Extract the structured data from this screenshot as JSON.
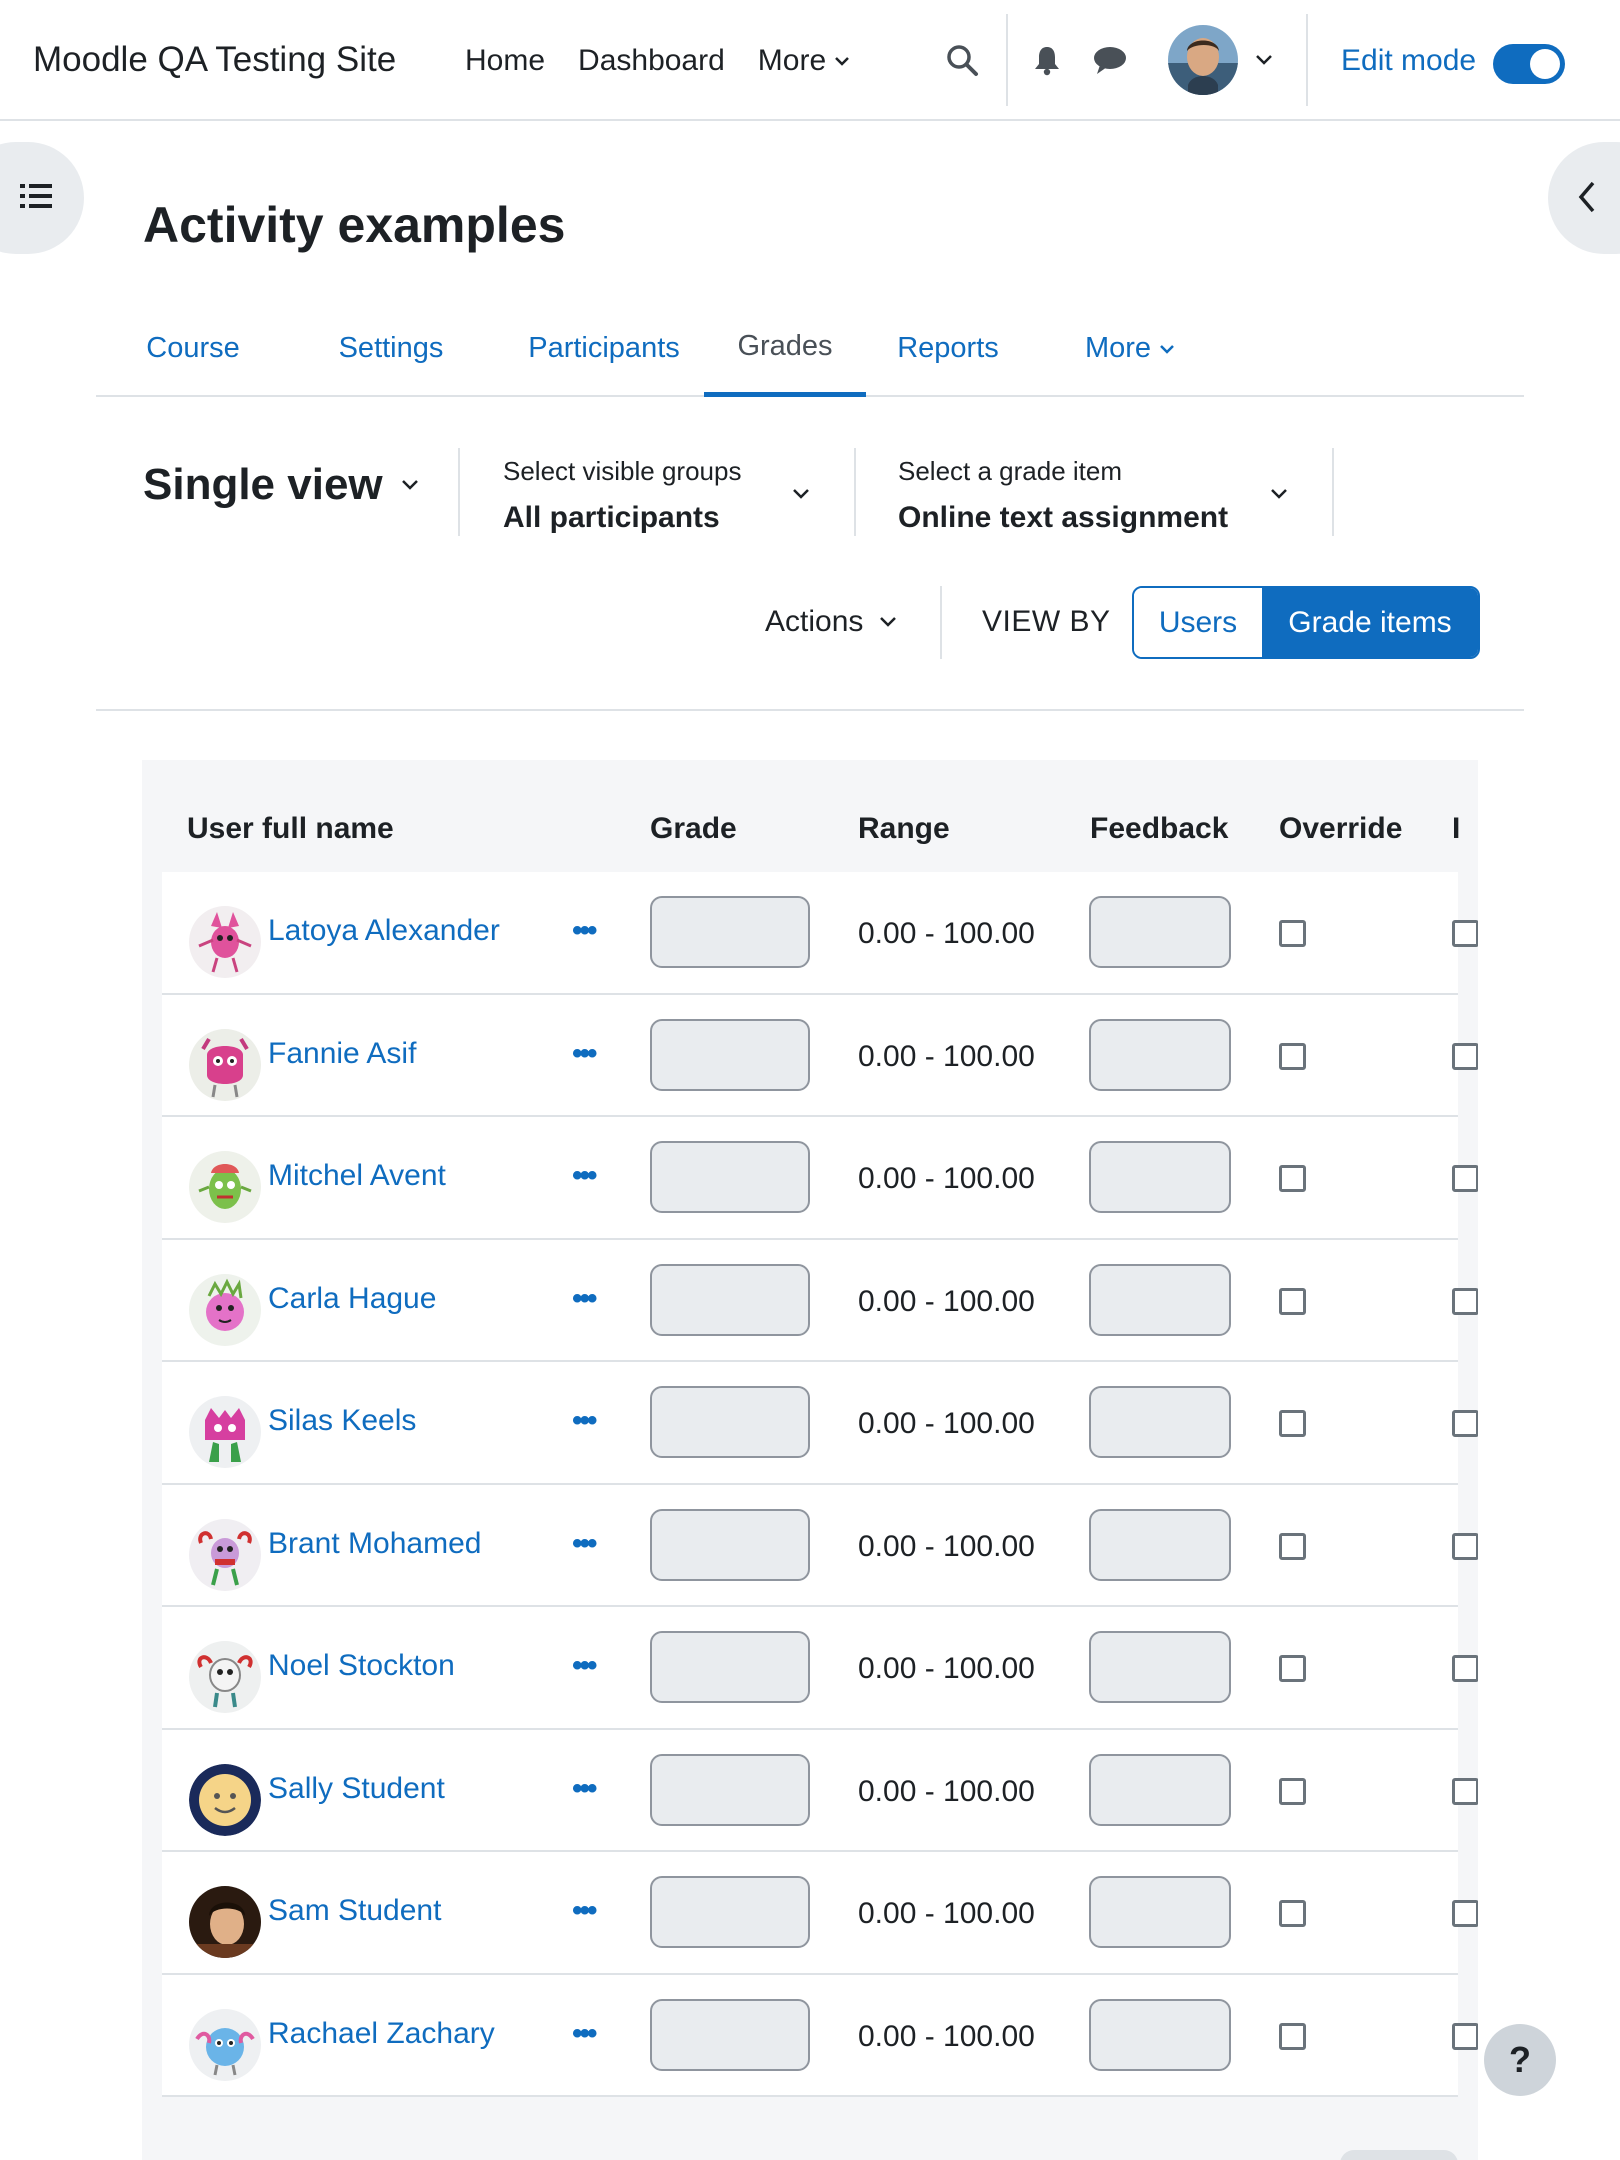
{
  "navbar": {
    "site_name": "Moodle QA Testing Site",
    "links": [
      "Home",
      "Dashboard",
      "More"
    ],
    "edit_mode_label": "Edit mode",
    "edit_mode_on": true,
    "icons": [
      "search-icon",
      "bell-icon",
      "chat-icon",
      "chevron-down-icon"
    ]
  },
  "page": {
    "title": "Activity examples"
  },
  "tabs": {
    "items": [
      "Course",
      "Settings",
      "Participants",
      "Grades",
      "Reports",
      "More"
    ],
    "active": "Grades"
  },
  "tertiary": {
    "view_label": "Single view",
    "groups_label": "Select visible groups",
    "groups_value": "All participants",
    "grade_item_label": "Select a grade item",
    "grade_item_value": "Online text assignment",
    "actions_label": "Actions",
    "view_by_label": "VIEW BY",
    "view_by_users": "Users",
    "view_by_grade_items": "Grade items",
    "view_by_active": "Grade items"
  },
  "table": {
    "headers": [
      "User full name",
      "Grade",
      "Range",
      "Feedback",
      "Override",
      "I"
    ],
    "rows": [
      {
        "name": "Latoya Alexander",
        "range": "0.00 - 100.00"
      },
      {
        "name": "Fannie Asif",
        "range": "0.00 - 100.00"
      },
      {
        "name": "Mitchel Avent",
        "range": "0.00 - 100.00"
      },
      {
        "name": "Carla Hague",
        "range": "0.00 - 100.00"
      },
      {
        "name": "Silas Keels",
        "range": "0.00 - 100.00"
      },
      {
        "name": "Brant Mohamed",
        "range": "0.00 - 100.00"
      },
      {
        "name": "Noel Stockton",
        "range": "0.00 - 100.00"
      },
      {
        "name": "Sally Student",
        "range": "0.00 - 100.00"
      },
      {
        "name": "Sam Student",
        "range": "0.00 - 100.00"
      },
      {
        "name": "Rachael Zachary",
        "range": "0.00 - 100.00"
      }
    ],
    "row_menu_label": "•••"
  },
  "help": {
    "label": "?"
  },
  "colors": {
    "primary": "#0f6cbf",
    "text": "#1d2125",
    "border": "#dee2e6",
    "table_bg": "#f5f6f8"
  }
}
